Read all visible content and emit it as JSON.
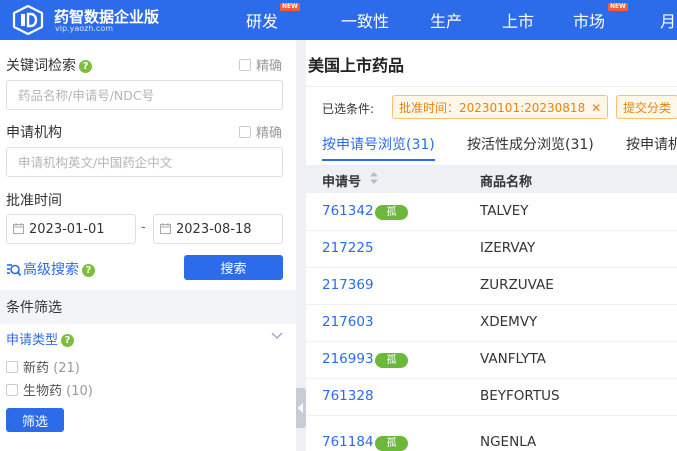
{
  "header": {
    "logo_title": "药智数据企业版",
    "logo_url": "vip.yaozh.com",
    "nav": [
      {
        "label": "研发",
        "badge": "NEW"
      },
      {
        "label": "一致性",
        "badge": ""
      },
      {
        "label": "生产",
        "badge": ""
      },
      {
        "label": "上市",
        "badge": ""
      },
      {
        "label": "市场",
        "badge": "NEW"
      },
      {
        "label": "月",
        "badge": ""
      }
    ]
  },
  "sidebar": {
    "keyword_label": "关键词检索",
    "keyword_exact": "精确",
    "keyword_placeholder": "药品名称/申请号/NDC号",
    "applicant_label": "申请机构",
    "applicant_exact": "精确",
    "applicant_placeholder": "申请机构英文/中国药企中文",
    "approval_label": "批准时间",
    "date_from": "2023-01-01",
    "date_sep": "-",
    "date_to": "2023-08-18",
    "advanced_search": "高级搜索",
    "search_button": "搜索",
    "filter_title": "条件筛选",
    "app_type_label": "申请类型",
    "options": [
      {
        "label": "新药",
        "count": "(21)"
      },
      {
        "label": "生物药",
        "count": "(10)"
      }
    ],
    "filter_button": "筛选"
  },
  "main": {
    "title": "美国上市药品",
    "selected_label": "已选条件:",
    "tags": [
      {
        "label": "批准时间：20230101:20230818"
      },
      {
        "label": "提交分类"
      }
    ],
    "tabs": [
      {
        "label": "按申请号浏览(31)",
        "active": true
      },
      {
        "label": "按活性成分浏览(31)",
        "active": false
      },
      {
        "label": "按申请机",
        "active": false
      }
    ],
    "table": {
      "columns": [
        "申请号",
        "商品名称"
      ],
      "rows": [
        {
          "app_no": "761342",
          "badge": "孤",
          "name": "TALVEY"
        },
        {
          "app_no": "217225",
          "badge": "",
          "name": "IZERVAY"
        },
        {
          "app_no": "217369",
          "badge": "",
          "name": "ZURZUVAE"
        },
        {
          "app_no": "217603",
          "badge": "",
          "name": "XDEMVY"
        },
        {
          "app_no": "216993",
          "badge": "孤",
          "name": "VANFLYTA"
        },
        {
          "app_no": "761328",
          "badge": "",
          "name": "BEYFORTUS"
        },
        {
          "app_no": "761184",
          "badge": "孤",
          "name": "NGENLA"
        }
      ]
    }
  },
  "colors": {
    "brand_blue": "#2c6bea",
    "orphan_green": "#6cb83a",
    "tag_orange": "#e8830f",
    "new_badge": "#ff5a36"
  }
}
